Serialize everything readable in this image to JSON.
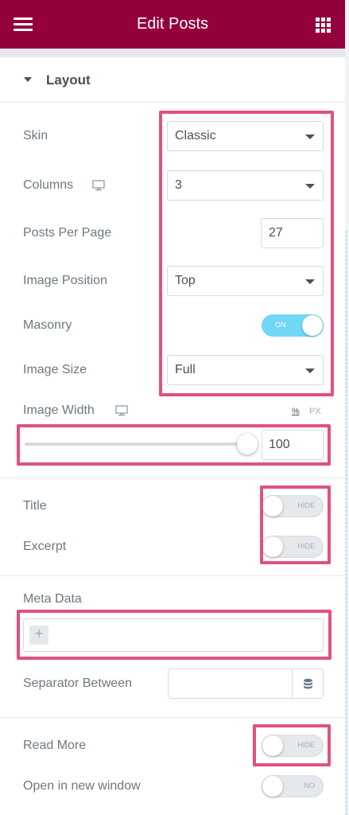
{
  "header": {
    "title": "Edit Posts",
    "menu_icon": "hamburger-icon",
    "apps_icon": "grid-icon"
  },
  "section": {
    "title": "Layout"
  },
  "fields": {
    "skin": {
      "label": "Skin",
      "value": "Classic"
    },
    "columns": {
      "label": "Columns",
      "value": "3"
    },
    "posts_per_page": {
      "label": "Posts Per Page",
      "value": "27"
    },
    "image_position": {
      "label": "Image Position",
      "value": "Top"
    },
    "masonry": {
      "label": "Masonry",
      "state": "ON"
    },
    "image_size": {
      "label": "Image Size",
      "value": "Full"
    },
    "image_width": {
      "label": "Image Width",
      "value": "100",
      "unit_percent": "%",
      "unit_px": "PX",
      "slider_fraction": 1.0
    },
    "title": {
      "label": "Title",
      "state": "HIDE"
    },
    "excerpt": {
      "label": "Excerpt",
      "state": "HIDE"
    },
    "meta_data": {
      "label": "Meta Data",
      "add_symbol": "+"
    },
    "separator_between": {
      "label": "Separator Between",
      "value": ""
    },
    "read_more": {
      "label": "Read More",
      "state": "HIDE"
    },
    "open_new_window": {
      "label": "Open in new window",
      "state": "NO"
    }
  },
  "colors": {
    "header": "#93003c",
    "accent_on": "#71d7f7",
    "highlight": "#e0517f"
  }
}
